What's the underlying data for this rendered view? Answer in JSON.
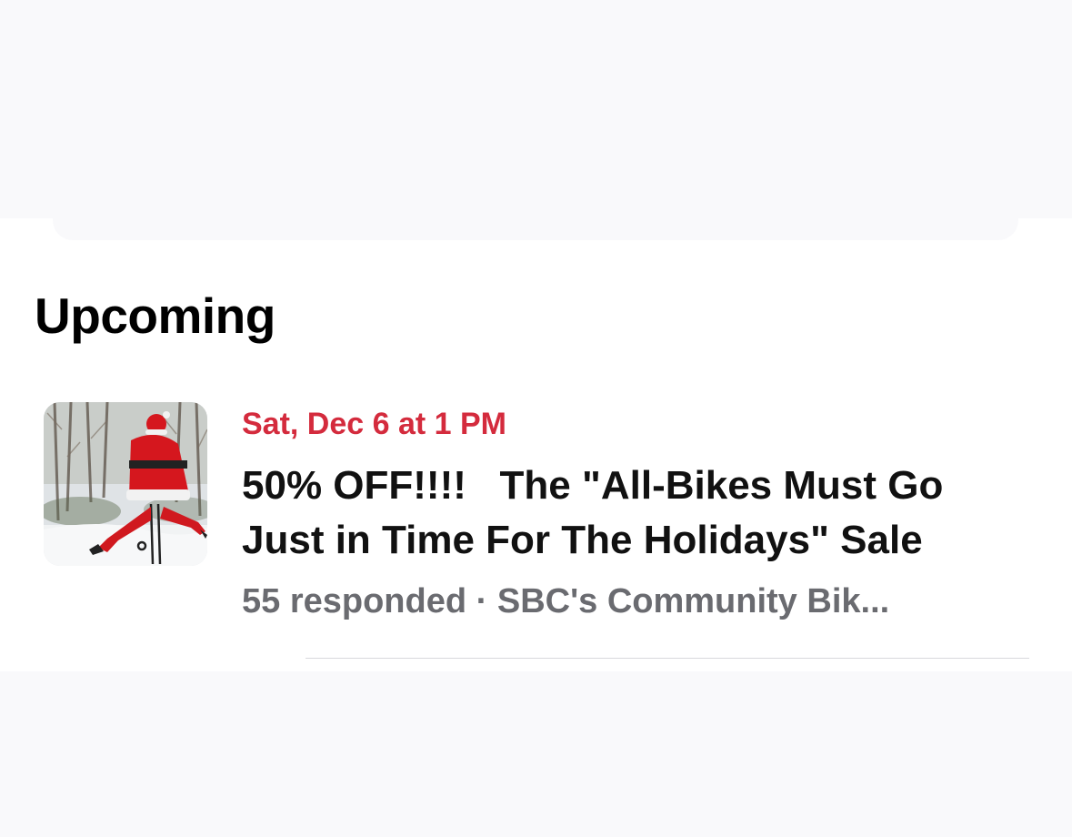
{
  "section": {
    "title": "Upcoming"
  },
  "events": [
    {
      "date": "Sat, Dec 6 at 1 PM",
      "title_line1": "50% OFF!!!!   The \"All-Bikes Must Go",
      "title_line2": "Just in Time For The Holidays\" Sale",
      "responded": "55 responded",
      "separator": "·",
      "organizer": "SBC's Community Bik...",
      "thumbnail": "santa-riding-bicycle-in-snow"
    }
  ],
  "colors": {
    "date": "#d42b3d",
    "title": "#111111",
    "meta": "#6a6b70",
    "background": "#f9f9fb",
    "panel": "#ffffff"
  }
}
